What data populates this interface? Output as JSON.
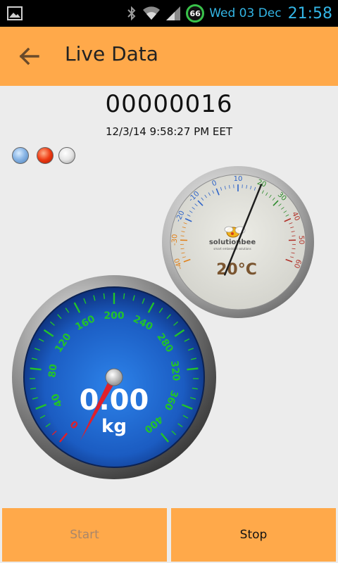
{
  "status_bar": {
    "battery": "66",
    "date": "Wed 03 Dec",
    "time": "21:58",
    "icons": [
      "image-icon",
      "bluetooth-icon",
      "wifi-icon",
      "signal-icon",
      "battery-icon"
    ]
  },
  "action_bar": {
    "title": "Live Data",
    "back_icon": "arrow-left-icon"
  },
  "device": {
    "id": "00000016",
    "timestamp": "12/3/14 9:58:27 PM EET"
  },
  "indicators": [
    {
      "name": "blue",
      "color": "#8ab6e6"
    },
    {
      "name": "red",
      "color": "#ee3a12"
    },
    {
      "name": "white",
      "color": "#e4e4e4"
    }
  ],
  "thermometer": {
    "value_label": "20°C",
    "value": 20,
    "brand": "solutionbee",
    "tagline": "smart embedded solutions",
    "ticks": [
      "-40",
      "-30",
      "-20",
      "-10",
      "0",
      "10",
      "20",
      "30",
      "40",
      "50",
      "60"
    ]
  },
  "weight_gauge": {
    "value": "0.00",
    "unit": "kg",
    "ticks": [
      "0",
      "40",
      "80",
      "120",
      "160",
      "200",
      "240",
      "280",
      "320",
      "360",
      "400"
    ]
  },
  "buttons": {
    "start": "Start",
    "stop": "Stop"
  },
  "colors": {
    "accent": "#ffa94a",
    "status_text": "#33b5e5",
    "tick_green": "#22c32a",
    "gauge_blue": "#1f62c8"
  }
}
